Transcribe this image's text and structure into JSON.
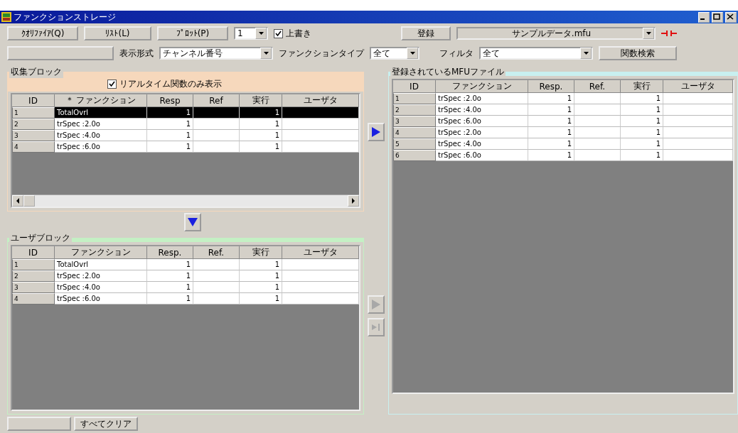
{
  "window": {
    "title": "ファンクションストレージ"
  },
  "toolbar": {
    "buttons": [
      {
        "label": "ｸｵﾘﾌｧｲｱ(Q)"
      },
      {
        "label": "ﾘｽﾄ(L)"
      },
      {
        "label": "ﾌﾟﾛｯﾄ(P)"
      }
    ],
    "plot_number": "1",
    "overwrite": {
      "label": "上書き",
      "checked": true
    },
    "register_button": "登録",
    "file": "サンプルデータ.mfu"
  },
  "options": {
    "display_format": {
      "label": "表示形式",
      "value": "チャンネル番号"
    },
    "function_type": {
      "label": "ファンクションタイプ",
      "value": "全て"
    },
    "filter": {
      "label": "フィルタ",
      "value": "全て"
    },
    "search_button": "関数検索"
  },
  "collection_block": {
    "title": "収集ブロック",
    "realtime_only": {
      "label": "リアルタイム関数のみ表示",
      "checked": true
    },
    "columns": [
      "ID",
      "＊ ファンクション",
      "Resp",
      "Ref",
      "実行",
      "ユーザタ"
    ],
    "rows": [
      {
        "id": "1",
        "function": "TotalOvrl",
        "resp": "1",
        "exec": "1",
        "selected": true
      },
      {
        "id": "2",
        "function": "trSpec :2.0o",
        "resp": "1",
        "exec": "1",
        "selected": false
      },
      {
        "id": "3",
        "function": "trSpec :4.0o",
        "resp": "1",
        "exec": "1",
        "selected": false
      },
      {
        "id": "4",
        "function": "trSpec :6.0o",
        "resp": "1",
        "exec": "1",
        "selected": false
      }
    ]
  },
  "move_down": {
    "disabled": false
  },
  "user_block": {
    "title": "ユーザブロック",
    "columns": [
      "ID",
      "ファンクション",
      "Resp.",
      "Ref.",
      "実行",
      "ユーザタ"
    ],
    "rows": [
      {
        "id": "1",
        "function": "TotalOvrl",
        "resp": "1",
        "exec": "1",
        "selected": false
      },
      {
        "id": "2",
        "function": "trSpec :2.0o",
        "resp": "1",
        "exec": "1",
        "selected": false
      },
      {
        "id": "3",
        "function": "trSpec :4.0o",
        "resp": "1",
        "exec": "1",
        "selected": false
      },
      {
        "id": "4",
        "function": "trSpec :6.0o",
        "resp": "1",
        "exec": "1",
        "selected": false
      }
    ]
  },
  "transfer_buttons": [
    {
      "kind": "arrow",
      "disabled": false
    },
    {
      "kind": "arrow",
      "disabled": true
    },
    {
      "kind": "arrow_bar",
      "disabled": true
    }
  ],
  "registered_block": {
    "title": "登録されているMFUファイル",
    "columns": [
      "ID",
      "ファンクション",
      "Resp.",
      "Ref.",
      "実行",
      "ユーザタ"
    ],
    "rows": [
      {
        "id": "1",
        "function": "trSpec :2.0o",
        "resp": "1",
        "exec": "1",
        "selected": false
      },
      {
        "id": "2",
        "function": "trSpec :4.0o",
        "resp": "1",
        "exec": "1",
        "selected": false
      },
      {
        "id": "3",
        "function": "trSpec :6.0o",
        "resp": "1",
        "exec": "1",
        "selected": false
      },
      {
        "id": "4",
        "function": "trSpec :2.0o",
        "resp": "1",
        "exec": "1",
        "selected": false
      },
      {
        "id": "5",
        "function": "trSpec :4.0o",
        "resp": "1",
        "exec": "1",
        "selected": false
      },
      {
        "id": "6",
        "function": "trSpec :6.0o",
        "resp": "1",
        "exec": "1",
        "selected": false
      }
    ]
  },
  "bottom": {
    "clear_all_button": "すべてクリア"
  }
}
